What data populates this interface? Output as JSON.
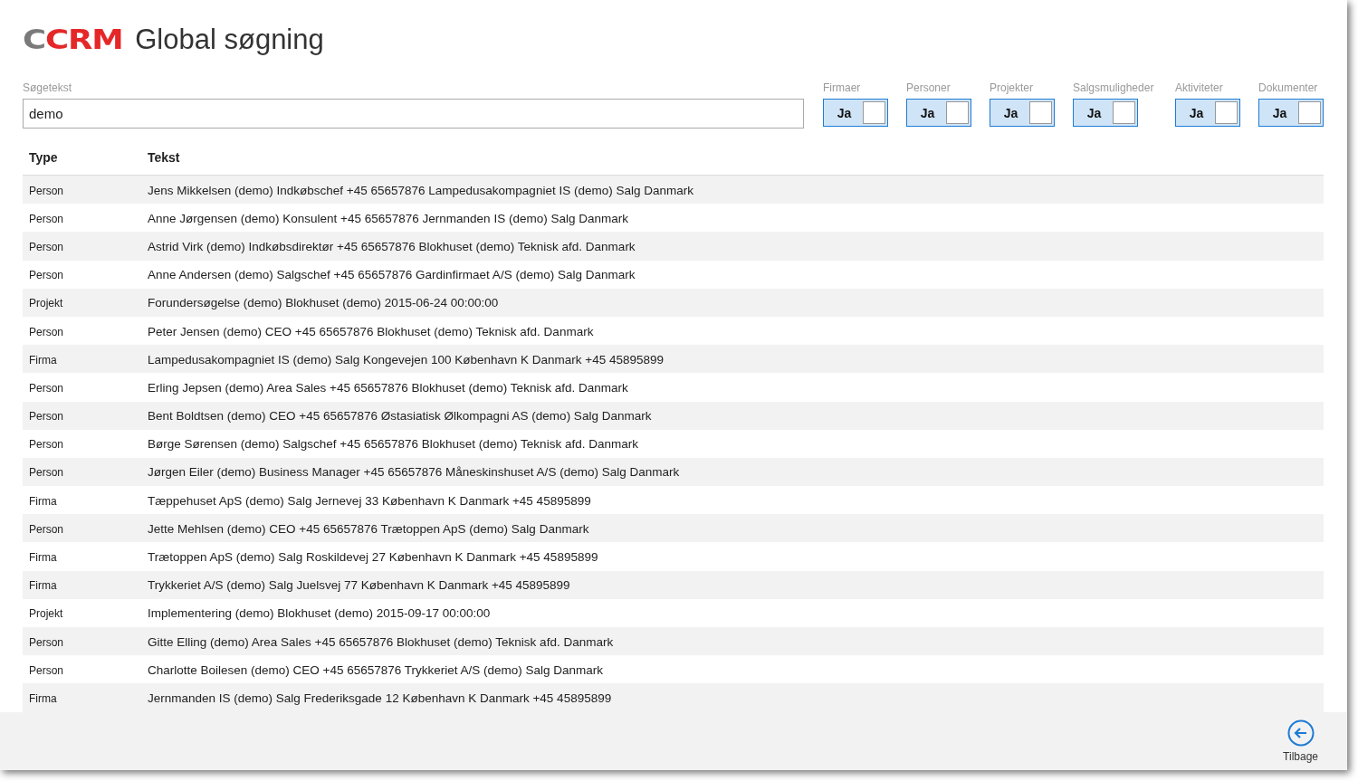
{
  "header": {
    "logo": "CCRM",
    "title": "Global søgning"
  },
  "search": {
    "label": "Søgetekst",
    "value": "demo"
  },
  "filters": [
    {
      "label": "Firmaer",
      "state_text": "Ja",
      "on": true
    },
    {
      "label": "Personer",
      "state_text": "Ja",
      "on": true
    },
    {
      "label": "Projekter",
      "state_text": "Ja",
      "on": true
    },
    {
      "label": "Salgsmuligheder",
      "state_text": "Ja",
      "on": true
    },
    {
      "label": "Aktiviteter",
      "state_text": "Ja",
      "on": true
    },
    {
      "label": "Dokumenter",
      "state_text": "Ja",
      "on": true
    }
  ],
  "table": {
    "columns": [
      "Type",
      "Tekst"
    ],
    "rows": [
      [
        "Person",
        "Jens Mikkelsen (demo) Indkøbschef +45 65657876 Lampedusakompagniet IS (demo) Salg Danmark"
      ],
      [
        "Person",
        "Anne Jørgensen (demo) Konsulent +45 65657876 Jernmanden IS (demo) Salg Danmark"
      ],
      [
        "Person",
        "Astrid Virk (demo) Indkøbsdirektør +45 65657876 Blokhuset (demo) Teknisk afd. Danmark"
      ],
      [
        "Person",
        "Anne Andersen (demo) Salgschef +45 65657876 Gardinfirmaet A/S (demo) Salg Danmark"
      ],
      [
        "Projekt",
        "Forundersøgelse (demo) Blokhuset (demo) 2015-06-24 00:00:00"
      ],
      [
        "Person",
        "Peter Jensen (demo) CEO +45 65657876 Blokhuset (demo) Teknisk afd. Danmark"
      ],
      [
        "Firma",
        "Lampedusakompagniet IS (demo) Salg Kongevejen 100 København K Danmark +45 45895899"
      ],
      [
        "Person",
        "Erling Jepsen (demo) Area Sales +45 65657876 Blokhuset (demo) Teknisk afd. Danmark"
      ],
      [
        "Person",
        "Bent Boldtsen (demo) CEO +45 65657876 Østasiatisk Ølkompagni AS (demo) Salg Danmark"
      ],
      [
        "Person",
        "Børge Sørensen (demo) Salgschef +45 65657876 Blokhuset (demo) Teknisk afd. Danmark"
      ],
      [
        "Person",
        "Jørgen Eiler (demo) Business Manager +45 65657876 Måneskinshuset A/S (demo) Salg Danmark"
      ],
      [
        "Firma",
        "Tæppehuset ApS (demo) Salg Jernevej 33 København K Danmark +45 45895899"
      ],
      [
        "Person",
        "Jette Mehlsen (demo) CEO +45 65657876 Trætoppen ApS (demo) Salg Danmark"
      ],
      [
        "Firma",
        "Trætoppen ApS (demo) Salg Roskildevej 27 København K Danmark +45 45895899"
      ],
      [
        "Firma",
        "Trykkeriet A/S (demo) Salg Juelsvej 77 København K Danmark +45 45895899"
      ],
      [
        "Projekt",
        "Implementering (demo) Blokhuset (demo) 2015-09-17 00:00:00"
      ],
      [
        "Person",
        "Gitte Elling (demo) Area Sales +45 65657876 Blokhuset (demo) Teknisk afd. Danmark"
      ],
      [
        "Person",
        "Charlotte Boilesen (demo) CEO +45 65657876 Trykkeriet A/S (demo) Salg Danmark"
      ],
      [
        "Firma",
        "Jernmanden IS (demo) Salg Frederiksgade 12 København K Danmark +45 45895899"
      ]
    ]
  },
  "app_bar": {
    "back_label": "Tilbage"
  }
}
